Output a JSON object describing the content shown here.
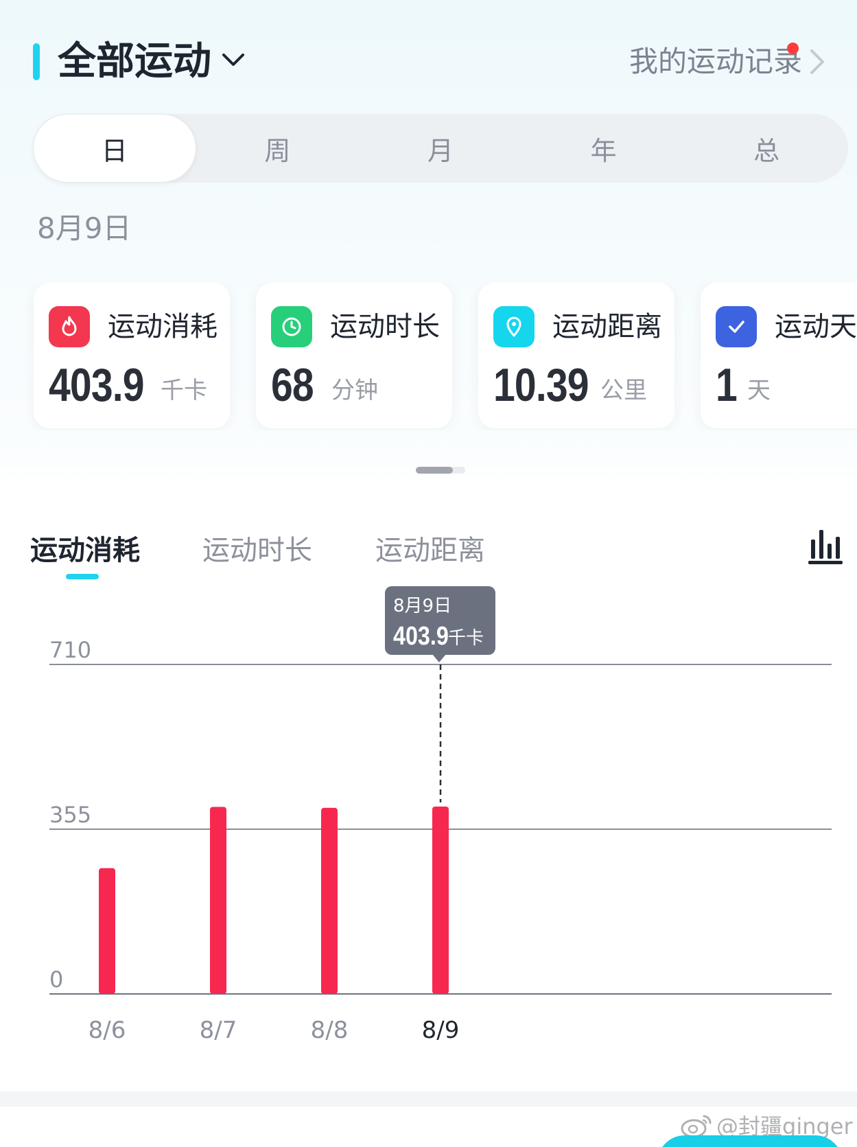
{
  "header": {
    "title": "全部运动",
    "records_link": "我的运动记录"
  },
  "period_tabs": [
    {
      "label": "日",
      "active": true
    },
    {
      "label": "周",
      "active": false
    },
    {
      "label": "月",
      "active": false
    },
    {
      "label": "年",
      "active": false
    },
    {
      "label": "总",
      "active": false
    }
  ],
  "date_label": "8月9日",
  "stats": [
    {
      "icon": "flame-icon",
      "color": "#f2374f",
      "label": "运动消耗",
      "value": "403.9",
      "unit": "千卡"
    },
    {
      "icon": "clock-icon",
      "color": "#27cf7b",
      "label": "运动时长",
      "value": "68",
      "unit": "分钟"
    },
    {
      "icon": "location-pin-icon",
      "color": "#16d6ee",
      "label": "运动距离",
      "value": "10.39",
      "unit": "公里"
    },
    {
      "icon": "checkmark-icon",
      "color": "#3d63e0",
      "label": "运动天数",
      "value": "1",
      "unit": "天"
    }
  ],
  "metric_tabs": [
    {
      "label": "运动消耗",
      "active": true
    },
    {
      "label": "运动时长",
      "active": false
    },
    {
      "label": "运动距离",
      "active": false
    }
  ],
  "tooltip": {
    "date": "8月9日",
    "value": "403.9",
    "unit": "千卡"
  },
  "colors": {
    "accent": "#1fd3ee",
    "bar": "#f72850",
    "tooltip_bg": "#6c7180"
  },
  "chart_data": {
    "type": "bar",
    "categories": [
      "8/6",
      "8/7",
      "8/8",
      "8/9"
    ],
    "values": [
      271,
      403,
      401,
      403.9
    ],
    "ylim": [
      0,
      710
    ],
    "yticks": [
      0,
      355,
      710
    ],
    "grid": true,
    "highlighted": "8/9"
  },
  "watermark": "@封疆ginger"
}
